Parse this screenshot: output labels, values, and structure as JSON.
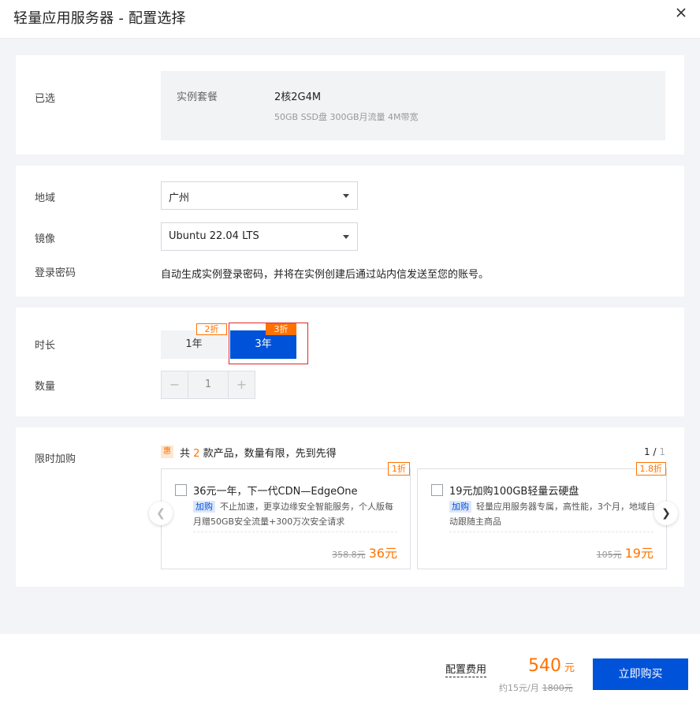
{
  "header": {
    "title": "轻量应用服务器 - 配置选择",
    "close_icon": "close-icon"
  },
  "selected": {
    "label": "已选",
    "key": "实例套餐",
    "value": "2核2G4M",
    "spec": "50GB SSD盘 300GB月流量 4M带宽"
  },
  "config": {
    "region_label": "地域",
    "region_value": "广州",
    "image_label": "镜像",
    "image_value": "Ubuntu 22.04 LTS",
    "password_label": "登录密码",
    "password_text": "自动生成实例登录密码，并将在实例创建后通过站内信发送至您的账号。"
  },
  "duration": {
    "label": "时长",
    "options": [
      {
        "label": "1年",
        "discount": "2折",
        "selected": false
      },
      {
        "label": "3年",
        "discount": "3折",
        "selected": true
      }
    ]
  },
  "quantity": {
    "label": "数量",
    "value": "1",
    "minus": "−",
    "plus": "+"
  },
  "promo": {
    "label": "限时加购",
    "badge": "惠",
    "text_prefix": "共",
    "count": "2",
    "text_suffix": "款产品，数量有限，先到先得",
    "page_current": "1 /",
    "page_total": "1",
    "items": [
      {
        "discount": "1折",
        "title": "36元一年，下一代CDN—EdgeOne",
        "tag": "加购",
        "desc": "不止加速，更享边缘安全智能服务，个人版每月赠50GB安全流量+300万次安全请求",
        "old_price": "358.8元",
        "price": "36元"
      },
      {
        "discount": "1.8折",
        "title": "19元加购100GB轻量云硬盘",
        "tag": "加购",
        "desc": "轻量应用服务器专属，高性能，3个月，地域自动跟随主商品",
        "old_price": "105元",
        "price": "19元"
      }
    ]
  },
  "footer": {
    "fee_label": "配置费用",
    "fee": "540",
    "fee_unit": "元",
    "monthly": "约15元/月",
    "old_price": "1800元",
    "buy_label": "立即购买"
  },
  "colors": {
    "primary": "#0052d9",
    "accent": "#ff7200",
    "highlight_border": "#e5262a"
  }
}
